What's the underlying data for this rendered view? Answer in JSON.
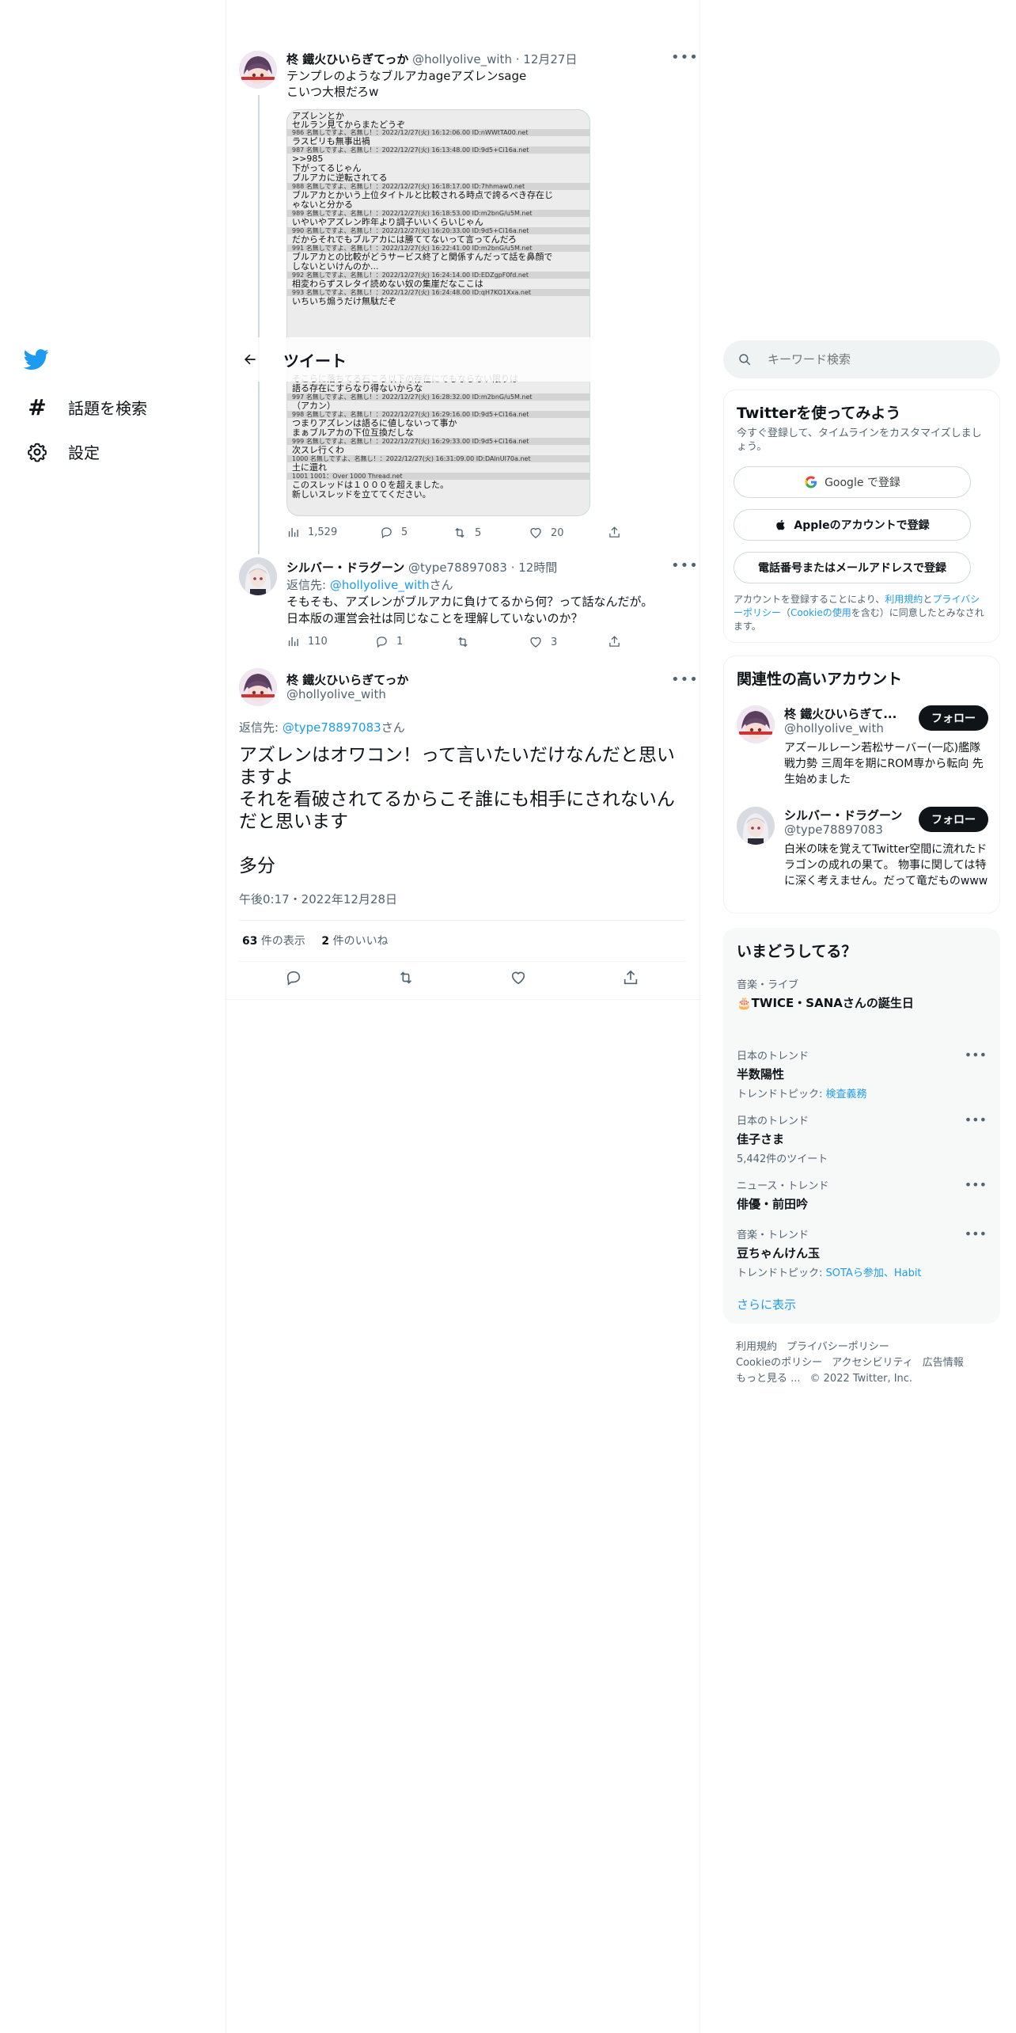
{
  "nav": {
    "search_label": "話題を検索",
    "settings_label": "設定"
  },
  "header": {
    "title": "ツイート"
  },
  "search": {
    "placeholder": "キーワード検索"
  },
  "tweets": {
    "t1": {
      "name": "柊 鐵火ひいらぎてっか",
      "handle": "@hollyolive_with",
      "date": "· 12月27日",
      "line1": "テンプレのようなブルアカageアズレンsage",
      "line2": "こいつ大根だろw",
      "views": "1,529",
      "replies": "5",
      "retweets": "5",
      "likes": "20"
    },
    "t2": {
      "name": "シルバー・ドラグーン",
      "handle": "@type78897083",
      "time": "· 12時間",
      "reply_prefix": "返信先: ",
      "reply_to": "@hollyolive_with",
      "reply_suffix": "さん",
      "line1": "そもそも、アズレンがブルアカに負けてるから何？って話なんだが。",
      "line2": "日本版の運営会社は同じなことを理解していないのか？",
      "views": "110",
      "replies": "1",
      "retweets": "",
      "likes": "3"
    },
    "main": {
      "name": "柊 鐵火ひいらぎてっか",
      "handle": "@hollyolive_with",
      "reply_prefix": "返信先: ",
      "reply_to": "@type78897083",
      "reply_suffix": "さん",
      "line1": "アズレンはオワコン！って言いたいだけなんだと思いますよ",
      "line2": "それを看破されてるからこそ誰にも相手にされないんだと思います",
      "line3": "多分",
      "timestamp": "午後0:17・2022年12月28日",
      "views_count": "63",
      "views_label": " 件の表示",
      "likes_count": "2",
      "likes_label": " 件のいいね"
    }
  },
  "screenshot": {
    "top_lines": [
      "アズレンとか",
      "セルラン見てからまたどうぞ"
    ],
    "rows": [
      {
        "num": "986",
        "meta": "名無しですよ、名無し！：2022/12/27(火) 16:12:06.00 ID:nWWtTA00.net",
        "text": "ラスピリも無事出禍"
      },
      {
        "num": "987",
        "meta": "名無しですよ、名無し！：2022/12/27(火) 16:13:48.00 ID:9d5+Ci16a.net",
        "text": ">>985"
      },
      {
        "num": "",
        "meta": "",
        "text": "下がってるじゃん"
      },
      {
        "num": "",
        "meta": "",
        "text": "ブルアカに逆転されてる"
      },
      {
        "num": "988",
        "meta": "名無しですよ、名無し！：2022/12/27(火) 16:18:17.00 ID:7hhmaw0.net",
        "text": "ブルアカとかいう上位タイトルと比較される時点で誇るべき存在じ"
      },
      {
        "num": "",
        "meta": "",
        "text": "ゃないと分かる"
      },
      {
        "num": "989",
        "meta": "名無しですよ、名無し！：2022/12/27(火) 16:18:53.00 ID:m2bnG/u5M.net",
        "text": "いやいやアズレン昨年より調子いいくらいじゃん"
      },
      {
        "num": "990",
        "meta": "名無しですよ、名無し！：2022/12/27(火) 16:20:33.00 ID:9d5+Ci16a.net",
        "text": "だからそれでもブルアカには勝ててないって言ってんだろ"
      },
      {
        "num": "991",
        "meta": "名無しですよ、名無し！：2022/12/27(火) 16:22:41.00 ID:m2bnG/u5M.net",
        "text": "ブルアカとの比較がどうサービス終了と関係すんだって話を鼻顔で"
      },
      {
        "num": "",
        "meta": "",
        "text": "しないといけんのか..."
      },
      {
        "num": "992",
        "meta": "名無しですよ、名無し！：2022/12/27(火) 16:24:14.00 ID:EDZgpF0fd.net",
        "text": "相変わらずスレタイ読めない奴の集崖だなここは"
      },
      {
        "num": "993",
        "meta": "名無しですよ、名無し！：2022/12/27(火) 16:24:48.00 ID:qH7KO1Xxa.net",
        "text": "いちいち煽うだけ無駄だぞ"
      }
    ],
    "bottom_rows": [
      {
        "num": "",
        "meta": "",
        "text": "そこらに落ちてる石ころ以下の存在にでもならない限りは"
      },
      {
        "num": "",
        "meta": "",
        "text": "語る存在にすらなり得ないからな"
      },
      {
        "num": "997",
        "meta": "名無しですよ、名無し！：2022/12/27(火) 16:28:32.00 ID:m2bnG/u5M.net",
        "text": "（アカン）"
      },
      {
        "num": "998",
        "meta": "名無しですよ、名無し！：2022/12/27(火) 16:29:16.00 ID:9d5+Ci16a.net",
        "text": "つまりアズレンは語るに値しないって事か"
      },
      {
        "num": "",
        "meta": "",
        "text": "まぁブルアカの下位互換だしな"
      },
      {
        "num": "999",
        "meta": "名無しですよ、名無し！：2022/12/27(火) 16:29:33.00 ID:9d5+Ci16a.net",
        "text": "次スレ行くわ"
      },
      {
        "num": "1000",
        "meta": "名無しですよ、名無し！：2022/12/27(火) 16:31:09.00 ID:DAlnUl70a.net",
        "text": "土に還れ"
      },
      {
        "num": "1001",
        "meta": "1001：Over 1000 Thread.net",
        "text": "このスレッドは１０００を超えました。"
      },
      {
        "num": "",
        "meta": "",
        "text": "新しいスレッドを立ててください。"
      }
    ]
  },
  "signup": {
    "title": "Twitterを使ってみよう",
    "subtitle": "今すぐ登録して、タイムラインをカスタマイズしましょう。",
    "google": "Google で登録",
    "apple": "Appleのアカウントで登録",
    "phone": "電話番号またはメールアドレスで登録",
    "legal_a": "アカウントを登録することにより、",
    "legal_terms": "利用規約",
    "legal_b": "と",
    "legal_privacy": "プライバシーポリシー",
    "legal_c": "（",
    "legal_cookie": "Cookieの使用",
    "legal_d": "を含む）に同意したとみなされます。"
  },
  "related": {
    "title": "関連性の高いアカウント",
    "follow": "フォロー",
    "a1": {
      "name": "柊 鐵火ひいらぎて...",
      "handle": "@hollyolive_with",
      "bio": "アズールレーン若松サーバー(一応)艦隊戦力勢 三周年を期にROM専から転向 先生始めました"
    },
    "a2": {
      "name": "シルバー・ドラグーン",
      "handle": "@type78897083",
      "bio": "白米の味を覚えてTwitter空間に流れたドラゴンの成れの果て。 物事に関しては特に深く考えません。だって竜だものwww"
    }
  },
  "trends": {
    "title": "いまどうしてる？",
    "e1": {
      "cat": "音楽・ライブ",
      "title": "🎂TWICE・SANAさんの誕生日"
    },
    "e2": {
      "cat": "日本のトレンド",
      "title": "半数陽性",
      "topic_label": "トレンドトピック: ",
      "topic": "検査義務"
    },
    "e3": {
      "cat": "日本のトレンド",
      "title": "佳子さま",
      "count": "5,442件のツイート"
    },
    "e4": {
      "cat": "ニュース・トレンド",
      "title": "俳優・前田吟"
    },
    "e5": {
      "cat": "音楽・トレンド",
      "title": "豆ちゃんけん玉",
      "topic_label": "トレンドトピック: ",
      "topic": "SOTAら参加、Habit"
    },
    "more": "さらに表示"
  },
  "footer": {
    "terms": "利用規約",
    "privacy": "プライバシーポリシー",
    "cookie": "Cookieのポリシー",
    "accessibility": "アクセシビリティ",
    "ads": "広告情報",
    "more": "もっと見る ...",
    "copyright": "© 2022 Twitter, Inc."
  },
  "colors": {
    "accent": "#1d9bf0",
    "text": "#0f1419",
    "muted": "#536471",
    "border": "#eff3f4"
  }
}
